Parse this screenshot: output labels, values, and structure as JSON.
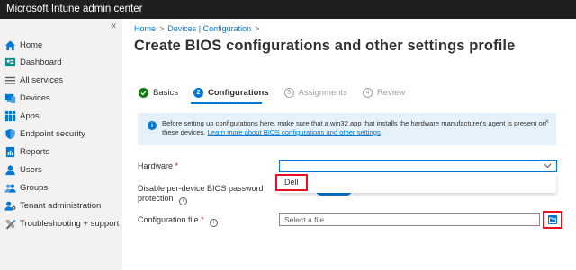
{
  "app": {
    "title": "Microsoft Intune admin center"
  },
  "sidebar": {
    "collapse_glyph": "«",
    "items": [
      {
        "label": "Home",
        "icon": "home-icon"
      },
      {
        "label": "Dashboard",
        "icon": "dashboard-icon"
      },
      {
        "label": "All services",
        "icon": "list-icon"
      },
      {
        "label": "Devices",
        "icon": "devices-icon"
      },
      {
        "label": "Apps",
        "icon": "apps-icon"
      },
      {
        "label": "Endpoint security",
        "icon": "shield-icon"
      },
      {
        "label": "Reports",
        "icon": "reports-icon"
      },
      {
        "label": "Users",
        "icon": "user-icon"
      },
      {
        "label": "Groups",
        "icon": "groups-icon"
      },
      {
        "label": "Tenant administration",
        "icon": "tenant-admin-icon"
      },
      {
        "label": "Troubleshooting + support",
        "icon": "tools-icon"
      }
    ]
  },
  "breadcrumb": {
    "items": [
      "Home",
      "Devices | Configuration"
    ],
    "separator": ">"
  },
  "page": {
    "title": "Create BIOS configurations and other settings profile",
    "more": "..."
  },
  "steps": [
    {
      "number": "",
      "label": "Basics",
      "state": "done"
    },
    {
      "number": "2",
      "label": "Configurations",
      "state": "active"
    },
    {
      "number": "3",
      "label": "Assignments",
      "state": "todo"
    },
    {
      "number": "4",
      "label": "Review",
      "state": "todo"
    }
  ],
  "info_banner": {
    "text": "Before setting up configurations here, make sure that a win32 app that installs the hardware manufacturer's agent is present on these devices.",
    "link": "Learn more about BIOS configurations and other settings",
    "close": "×"
  },
  "form": {
    "hardware": {
      "label": "Hardware",
      "required_mark": "*",
      "value": "",
      "options": [
        "Dell"
      ]
    },
    "disable_password": {
      "label_line1": "Disable per-device BIOS password",
      "label_line2": "protection",
      "info": "i"
    },
    "config_file": {
      "label": "Configuration file",
      "required_mark": "*",
      "info": "i",
      "placeholder": "Select a file"
    }
  },
  "colors": {
    "accent": "#0078d4",
    "highlight": "#e81123",
    "success": "#107c10",
    "topbar": "#1f1f1f"
  }
}
